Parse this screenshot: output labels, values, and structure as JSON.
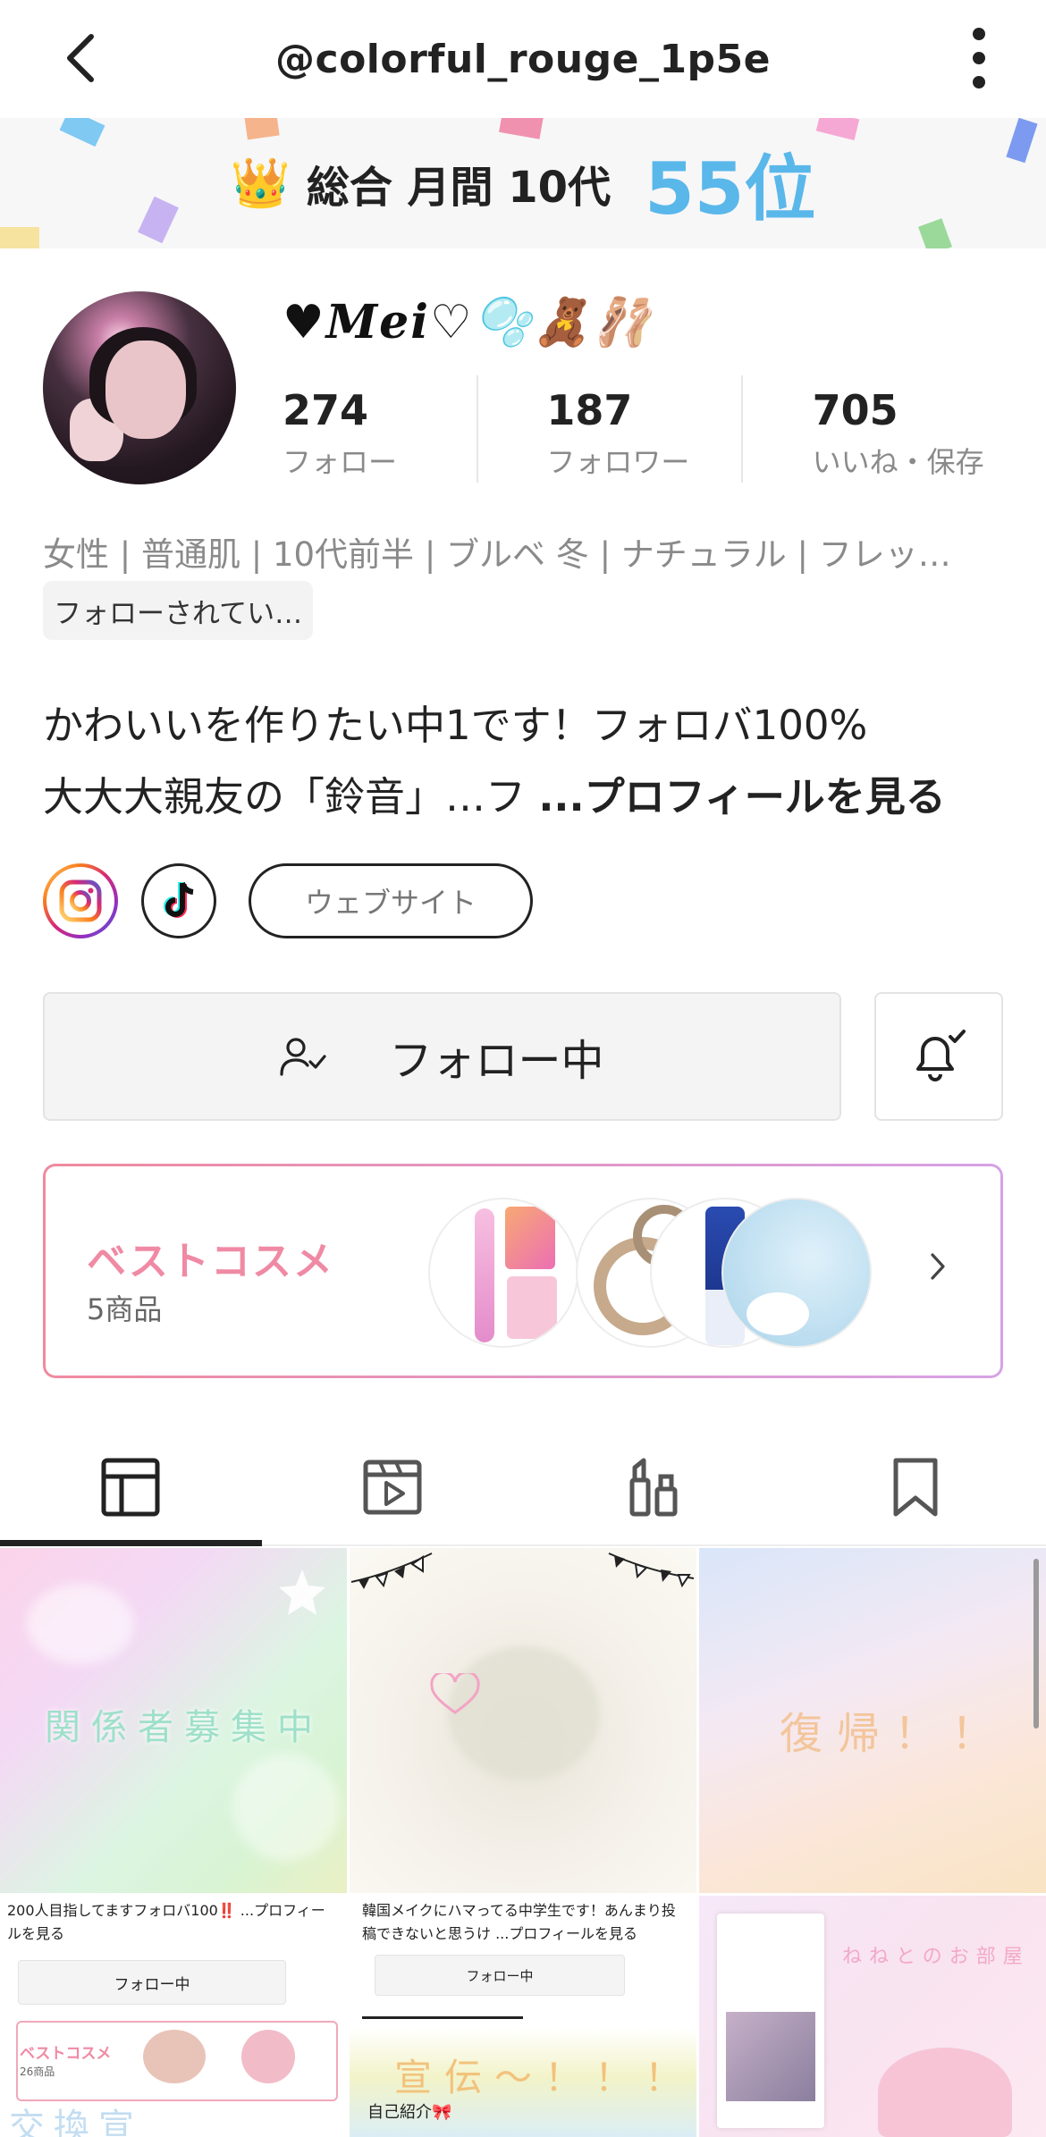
{
  "header": {
    "handle": "@colorful_rouge_1p5e"
  },
  "ranking": {
    "crown": "👑",
    "label": "総合 月間 10代",
    "value": "55位",
    "accent_color": "#5ab7ea"
  },
  "profile": {
    "display_name": "♥𝑴𝒆𝒊♡🫧🧸🩰",
    "stats": [
      {
        "value": "274",
        "label": "フォロー"
      },
      {
        "value": "187",
        "label": "フォロワー"
      },
      {
        "value": "705",
        "label": "いいね・保存"
      }
    ],
    "attributes": "女性 | 普通肌 | 10代前半 | ブルベ 冬 | ナチュラル | フレッ…",
    "follows_you": "フォローされてい…",
    "bio_line1": "かわいいを作りたい中1です！フォロバ100%",
    "bio_line2": "大大大親友の「鈴音」…フ ",
    "bio_more": "...プロフィールを見る",
    "website_label": "ウェブサイト"
  },
  "actions": {
    "follow_label": "フォロー中"
  },
  "best_cosme": {
    "title": "ベストコスメ",
    "count": "5商品"
  },
  "tabs": [
    {
      "icon": "grid-icon",
      "active": true
    },
    {
      "icon": "video-icon",
      "active": false
    },
    {
      "icon": "cosmetics-icon",
      "active": false
    },
    {
      "icon": "bookmark-icon",
      "active": false
    }
  ],
  "posts": [
    {
      "text": "関係者募集中"
    },
    {
      "text": ""
    },
    {
      "text": "復帰！！"
    },
    {
      "text": "交換宣伝〜！！！"
    },
    {
      "text": "宣伝〜！！！"
    },
    {
      "text": "ねねとのお部屋"
    }
  ],
  "post_screens": {
    "s4_bio": "200人目指してますフォロバ100‼️ ...プロフィールを見る",
    "s4_follow": "フォロー中",
    "s4_bc_title": "ベストコスメ",
    "s4_bc_count": "26商品",
    "s5_bio": "韓国メイクにハマってる中学生です！あんまり投稿できないと思うけ ...プロフィールを見る",
    "s5_follow": "フォロー中",
    "s5_intro": "自己紹介🎀"
  }
}
